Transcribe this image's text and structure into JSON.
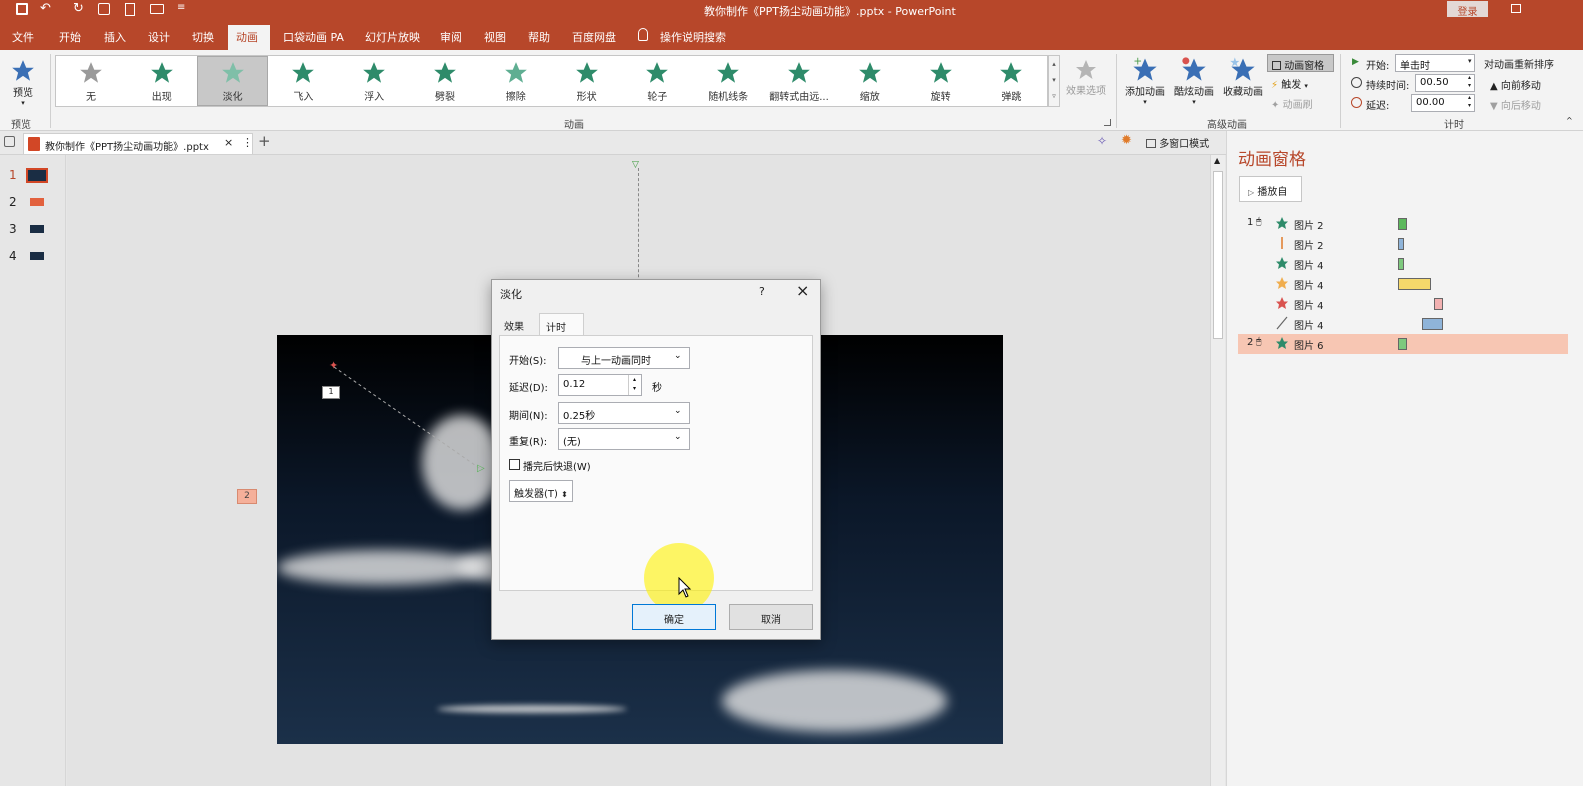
{
  "window": {
    "title": "教你制作《PPT扬尘动画功能》.pptx  -  PowerPoint",
    "login_label": "登录"
  },
  "menu": {
    "items": [
      "文件",
      "开始",
      "插入",
      "设计",
      "切换",
      "动画",
      "口袋动画 PA",
      "幻灯片放映",
      "审阅",
      "视图",
      "帮助",
      "百度网盘"
    ],
    "active": "动画",
    "search_label": "操作说明搜索"
  },
  "ribbon": {
    "preview_label": "预览",
    "preview_group": "预览",
    "gallery": [
      "无",
      "出现",
      "淡化",
      "飞入",
      "浮入",
      "劈裂",
      "擦除",
      "形状",
      "轮子",
      "随机线条",
      "翻转式由远...",
      "缩放",
      "旋转",
      "弹跳"
    ],
    "selected_effect": "淡化",
    "effect_options_label": "效果选项",
    "animation_group": "动画",
    "add_animation": "添加动画",
    "cool_animation": "酷炫动画",
    "collect_animation": "收藏动画",
    "animation_pane_btn": "动画窗格",
    "trigger_btn": "触发",
    "animation_brush": "动画刷",
    "advanced_group": "高级动画",
    "start_label": "开始:",
    "start_value": "单击时",
    "duration_label": "持续时间:",
    "duration_value": "00.50",
    "delay_label": "延迟:",
    "delay_value": "00.00",
    "timing_group": "计时",
    "reorder_label": "对动画重新排序",
    "move_earlier": "向前移动",
    "move_later": "向后移动"
  },
  "tabbar": {
    "doc_tab": "教你制作《PPT扬尘动画功能》.pptx",
    "multi_window": "多窗口模式"
  },
  "thumbnails": [
    "1",
    "2",
    "3",
    "4"
  ],
  "slide": {
    "tag_1": "1",
    "side_tag": "2"
  },
  "dialog": {
    "title": "淡化",
    "help": "?",
    "tabs": [
      "效果",
      "计时"
    ],
    "active_tab": "计时",
    "start_label": "开始(S):",
    "start_value": "与上一动画同时",
    "delay_label": "延迟(D):",
    "delay_value": "0.12",
    "delay_unit": "秒",
    "period_label": "期间(N):",
    "period_value": "0.25秒",
    "repeat_label": "重复(R):",
    "repeat_value": "(无)",
    "rewind_label": "播完后快退(W)",
    "trigger_label": "触发器(T)",
    "ok": "确定",
    "cancel": "取消"
  },
  "animation_pane": {
    "title": "动画窗格",
    "play_button": "播放自",
    "items": [
      {
        "num": "1",
        "name": "图片 2",
        "icon": "green-star",
        "bar_color": "#5cb85c",
        "start": 0.0,
        "width": 0.03
      },
      {
        "num": "",
        "name": "图片 2",
        "icon": "orange-line",
        "bar_color": "#8fb4d9",
        "start": 0.0,
        "width": 0.02
      },
      {
        "num": "",
        "name": "图片 4",
        "icon": "green-star",
        "bar_color": "#7ec97e",
        "start": 0.0,
        "width": 0.02
      },
      {
        "num": "",
        "name": "图片 4",
        "icon": "yellow-star",
        "bar_color": "#f5d86b",
        "start": 0.0,
        "width": 0.11
      },
      {
        "num": "",
        "name": "图片 4",
        "icon": "red-star",
        "bar_color": "#f2b1b1",
        "start": 0.12,
        "width": 0.03
      },
      {
        "num": "",
        "name": "图片 4",
        "icon": "path-line",
        "bar_color": "#8fb4d9",
        "start": 0.08,
        "width": 0.07
      },
      {
        "num": "2",
        "name": "图片 6",
        "icon": "green-star",
        "bar_color": "#7ec97e",
        "start": 0.0,
        "width": 0.03
      }
    ]
  },
  "colors": {
    "accent": "#b7472a",
    "selected_row": "#f7c6b3",
    "highlight": "#fff200"
  }
}
